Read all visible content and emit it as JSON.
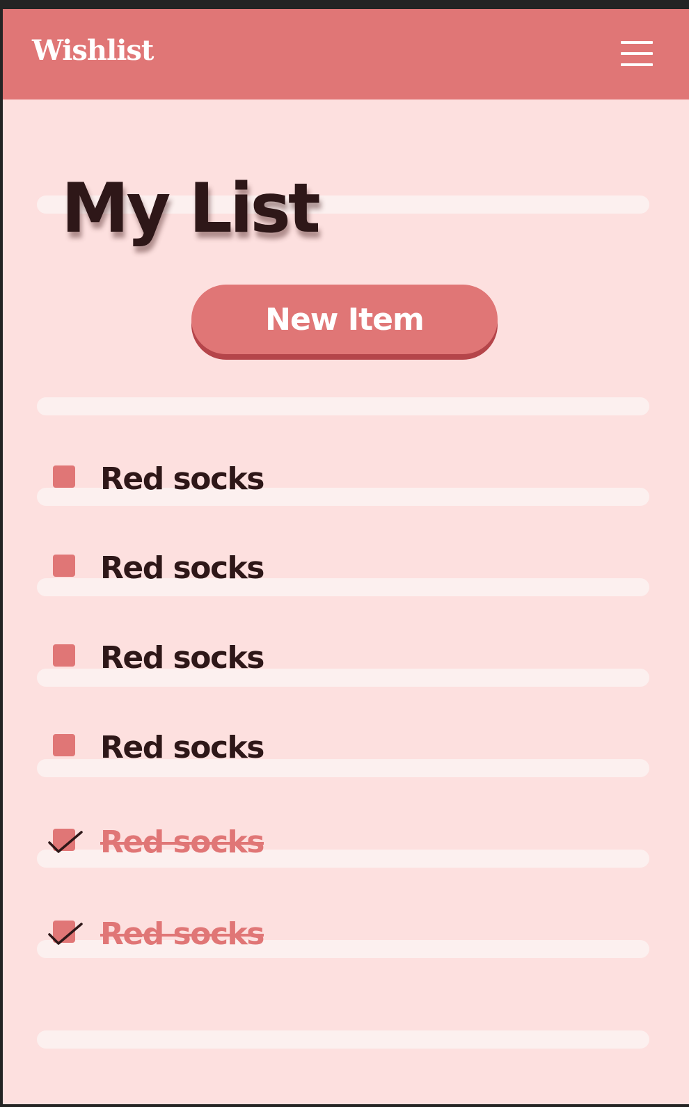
{
  "app": {
    "title": "Wishlist",
    "menu_icon": "hamburger-menu-icon"
  },
  "colors": {
    "header": "#e07676",
    "background": "#fde0df",
    "ruled_line": "#fcf0ef",
    "text": "#2e1718",
    "accent": "#e07676",
    "button_shadow": "#b5454a"
  },
  "page": {
    "title": "My List",
    "new_item_label": "New Item"
  },
  "items": [
    {
      "label": "Red socks",
      "checked": false
    },
    {
      "label": "Red socks",
      "checked": false
    },
    {
      "label": "Red socks",
      "checked": false
    },
    {
      "label": "Red socks",
      "checked": false
    },
    {
      "label": "Red socks",
      "checked": true
    },
    {
      "label": "Red socks",
      "checked": true
    }
  ]
}
